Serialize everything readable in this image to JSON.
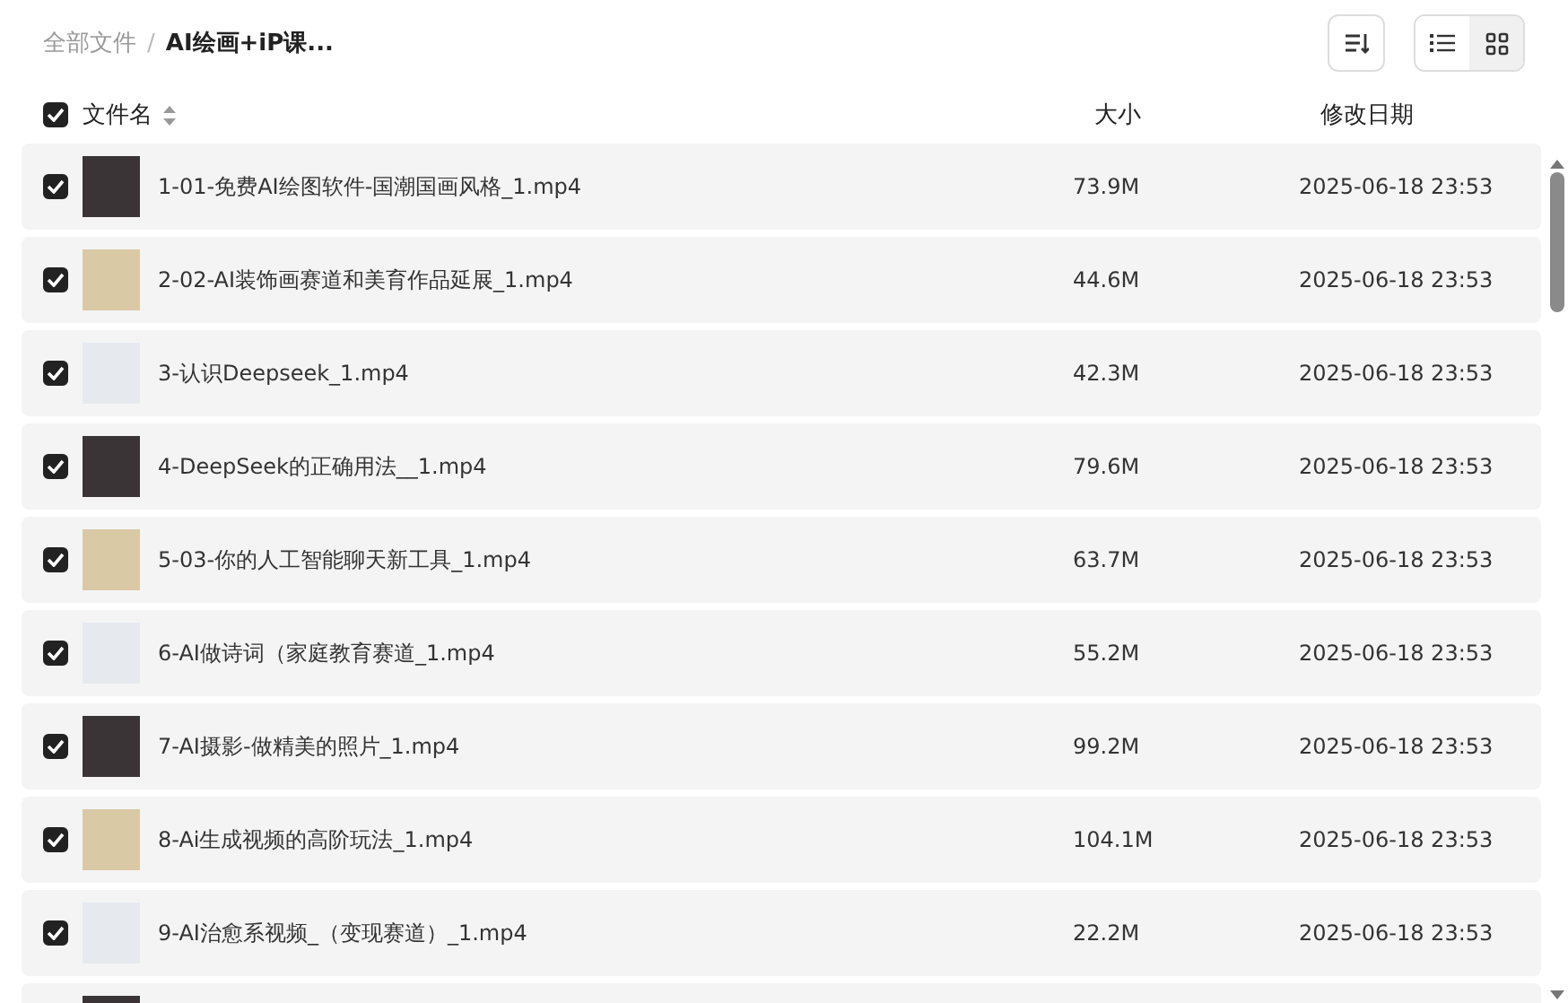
{
  "breadcrumb_separator": "/",
  "breadcrumb": [
    {
      "label": "全部文件",
      "current": false
    },
    {
      "label": "AI绘画+iP课...",
      "current": true
    }
  ],
  "view_modes": [
    {
      "kind": "list",
      "selected": true
    },
    {
      "kind": "grid",
      "selected": false
    }
  ],
  "table": {
    "select_all_checked": true,
    "columns": [
      {
        "label": "文件名",
        "sortable": true
      },
      {
        "label": "大小",
        "sortable": false
      },
      {
        "label": "修改日期",
        "sortable": false
      }
    ],
    "rows": [
      {
        "name": "1-01-免费AI绘图软件-国潮国画风格_1.mp4",
        "size": "73.9M",
        "modified": "2025-06-18 23:53",
        "checked": true
      },
      {
        "name": "2-02-AI装饰画赛道和美育作品延展_1.mp4",
        "size": "44.6M",
        "modified": "2025-06-18 23:53",
        "checked": true
      },
      {
        "name": "3-认识Deepseek_1.mp4",
        "size": "42.3M",
        "modified": "2025-06-18 23:53",
        "checked": true
      },
      {
        "name": "4-DeepSeek的正确用法__1.mp4",
        "size": "79.6M",
        "modified": "2025-06-18 23:53",
        "checked": true
      },
      {
        "name": "5-03-你的人工智能聊天新工具_1.mp4",
        "size": "63.7M",
        "modified": "2025-06-18 23:53",
        "checked": true
      },
      {
        "name": "6-AI做诗词（家庭教育赛道_1.mp4",
        "size": "55.2M",
        "modified": "2025-06-18 23:53",
        "checked": true
      },
      {
        "name": "7-AI摄影-做精美的照片_1.mp4",
        "size": "99.2M",
        "modified": "2025-06-18 23:53",
        "checked": true
      },
      {
        "name": "8-Ai生成视频的高阶玩法_1.mp4",
        "size": "104.1M",
        "modified": "2025-06-18 23:53",
        "checked": true
      },
      {
        "name": "9-AI治愈系视频_（变现赛道）_1.mp4",
        "size": "22.2M",
        "modified": "2025-06-18 23:53",
        "checked": true
      }
    ]
  }
}
